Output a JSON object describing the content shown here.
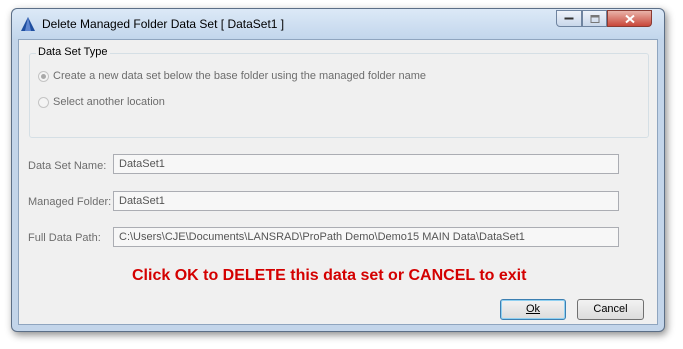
{
  "window": {
    "title": "Delete Managed Folder Data Set [ DataSet1 ]",
    "icon": "app-triangle-icon"
  },
  "group": {
    "title": "Data Set Type",
    "options": [
      {
        "label": "Create a new data set below the base folder using the managed folder name",
        "checked": true
      },
      {
        "label": "Select another location",
        "checked": false
      }
    ]
  },
  "fields": {
    "name": {
      "label": "Data Set Name:",
      "value": "DataSet1"
    },
    "folder": {
      "label": "Managed Folder:",
      "value": "DataSet1"
    },
    "path": {
      "label": "Full Data Path:",
      "value": "C:\\Users\\CJE\\Documents\\LANSRAD\\ProPath Demo\\Demo15 MAIN Data\\DataSet1"
    }
  },
  "warning": "Click OK to DELETE this data set or CANCEL to exit",
  "buttons": {
    "ok": "Ok",
    "cancel": "Cancel"
  },
  "colors": {
    "warning": "#d40000",
    "accent": "#1f4fa0"
  }
}
